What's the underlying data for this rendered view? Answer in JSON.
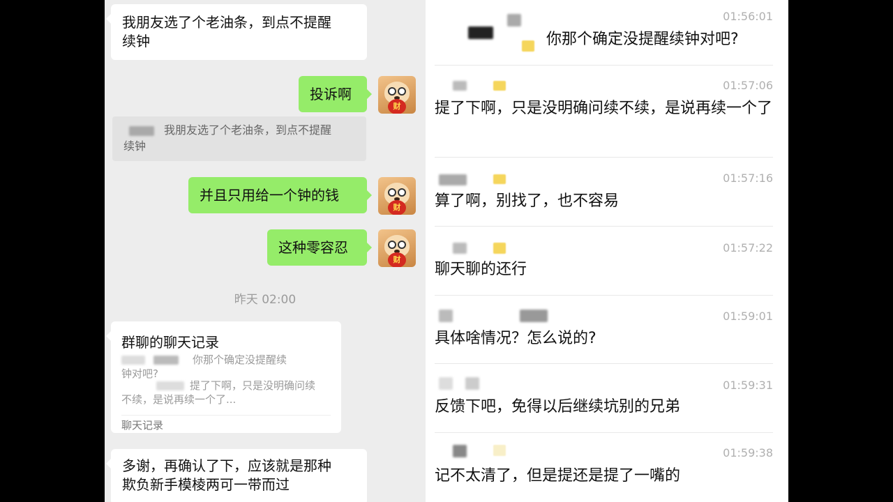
{
  "left_chat": {
    "msg1": {
      "line1": "我朋友选了个老油条，到点不提醒",
      "line2": "续钟"
    },
    "msg_complain": "投诉啊",
    "quote": {
      "line1": "我朋友选了个老油条，到点不提醒",
      "line2": "续钟"
    },
    "msg_only_pay": "并且只用给一个钟的钱",
    "msg_zero": "这种零容忍",
    "avatar_coin": "财",
    "timestamp": "昨天 02:00",
    "record_card": {
      "title": "群聊的聊天记录",
      "line1": "你那个确定没提醒续",
      "line2": "钟对吧?",
      "line3": "提了下啊，只是没明确问续",
      "line4": "不续，是说再续一个了...",
      "footer": "聊天记录"
    },
    "msg_thanks": {
      "line1": "多谢，再确认了下，应该就是那种",
      "line2": "欺负新手模棱两可一带而过"
    }
  },
  "right_records": {
    "messages": [
      {
        "time": "01:56:01",
        "text": "你那个确定没提醒续钟对吧?"
      },
      {
        "time": "01:57:06",
        "text": "提了下啊，只是没明确问续不续，是说再续一个了"
      },
      {
        "time": "01:57:16",
        "text": "算了啊，别找了，也不容易"
      },
      {
        "time": "01:57:22",
        "text": "聊天聊的还行"
      },
      {
        "time": "01:59:01",
        "text": "具体啥情况？怎么说的?"
      },
      {
        "time": "01:59:31",
        "text": "反馈下吧，免得以后继续坑别的兄弟"
      },
      {
        "time": "01:59:38",
        "text": "记不太清了，但是提还是提了一嘴的"
      }
    ]
  },
  "colors": {
    "out_bubble": "#95ec69",
    "chat_bg": "#ededed",
    "time_gray": "#b0b0b0"
  }
}
